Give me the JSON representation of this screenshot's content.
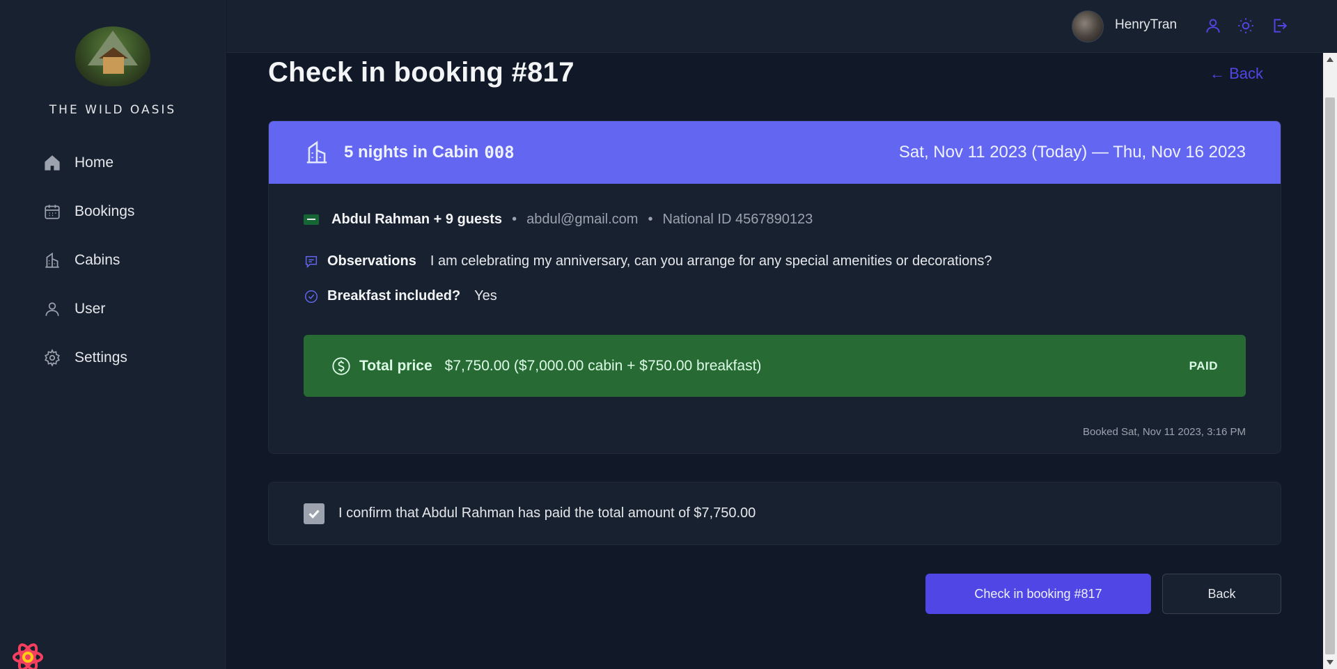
{
  "app": {
    "brand": "THE WILD OASIS"
  },
  "sidebar": {
    "items": [
      {
        "label": "Home",
        "icon": "home-icon"
      },
      {
        "label": "Bookings",
        "icon": "calendar-icon"
      },
      {
        "label": "Cabins",
        "icon": "cabin-icon"
      },
      {
        "label": "User",
        "icon": "user-icon"
      },
      {
        "label": "Settings",
        "icon": "gear-icon"
      }
    ]
  },
  "header": {
    "user_name": "HenryTran",
    "icons": [
      "user-icon",
      "sun-icon",
      "logout-icon"
    ]
  },
  "page": {
    "title": "Check in booking #817",
    "back_link": "← Back"
  },
  "booking": {
    "nights_label": "5 nights in Cabin",
    "cabin_number": "008",
    "dates": "Sat, Nov 11 2023 (Today) — Thu, Nov 16 2023",
    "guest": "Abdul Rahman + 9 guests",
    "email": "abdul@gmail.com",
    "national_id": "National ID 4567890123",
    "observations_label": "Observations",
    "observations": "I am celebrating my anniversary, can you arrange for any special amenities or decorations?",
    "breakfast_label": "Breakfast included?",
    "breakfast_value": "Yes",
    "total_label": "Total price",
    "total_value": "$7,750.00 ($7,000.00 cabin + $750.00 breakfast)",
    "status": "PAID",
    "booked_at": "Booked Sat, Nov 11 2023, 3:16 PM"
  },
  "confirm": {
    "text": "I confirm that Abdul Rahman has paid the total amount of $7,750.00",
    "checked": true
  },
  "actions": {
    "check_in_label": "Check in booking #817",
    "back_label": "Back"
  },
  "colors": {
    "accent": "#4f46e5",
    "header_band": "#6366f1",
    "paid_bg": "#276a34",
    "bg": "#111827",
    "panel": "#18212f"
  }
}
